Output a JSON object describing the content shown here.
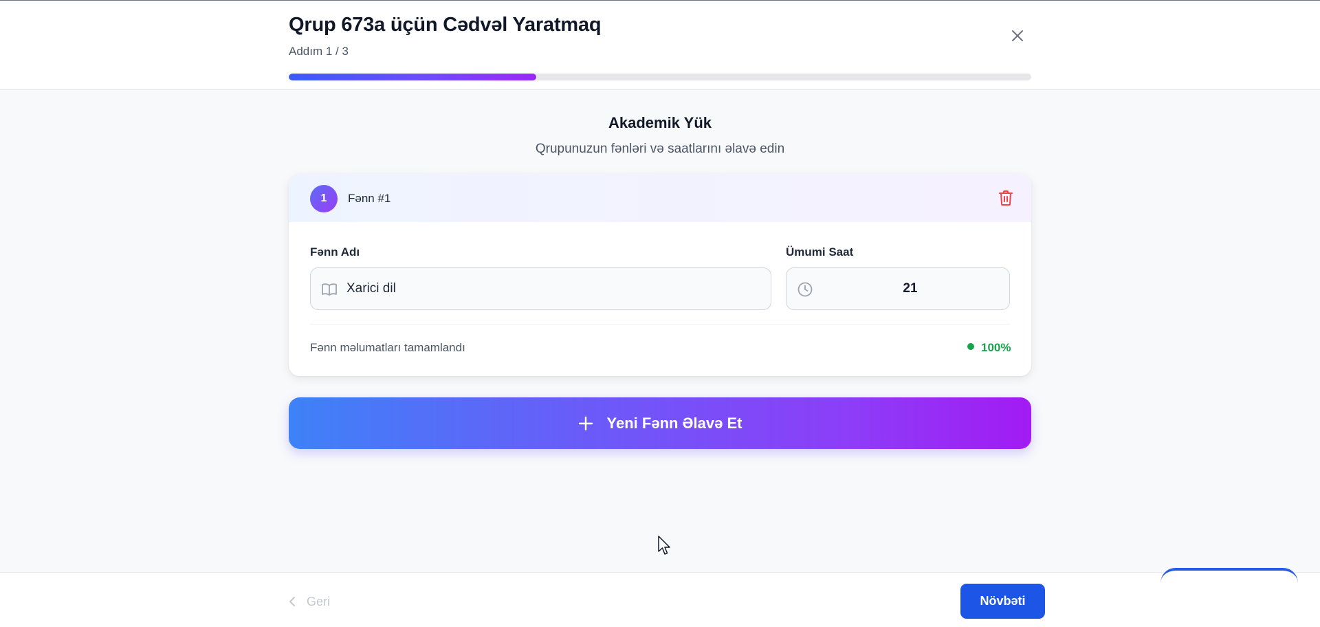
{
  "header": {
    "title": "Qrup 673a üçün Cədvəl Yaratmaq",
    "step": "Addım 1 / 3",
    "progress_fraction": 0.333
  },
  "section": {
    "title": "Akademik Yük",
    "subtitle": "Qrupunuzun fənləri və saatlarını əlavə edin"
  },
  "subject_card": {
    "number": "1",
    "label": "Fənn #1",
    "name_label": "Fənn Adı",
    "name_value": "Xarici dil",
    "hours_label": "Ümumi Saat",
    "hours_value": "21",
    "status_text": "Fənn məlumatları tamamlandı",
    "status_percent": "100%"
  },
  "add_button": {
    "label": "Yeni Fənn Əlavə Et"
  },
  "footer": {
    "back_label": "Geri",
    "next_label": "Növbəti"
  },
  "colors": {
    "primary": "#1d55e6",
    "success": "#16a34a",
    "danger": "#ef4444",
    "gradient_start": "#3e82f7",
    "gradient_end": "#a21bf3"
  },
  "icons": {
    "close": "close-icon",
    "delete": "trash-icon",
    "book": "book-icon",
    "clock": "clock-icon",
    "plus": "plus-icon",
    "back": "chevron-left-icon"
  }
}
